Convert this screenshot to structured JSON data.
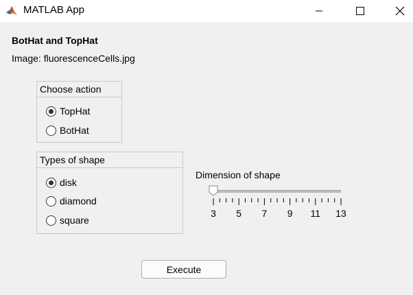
{
  "window": {
    "title": "MATLAB App"
  },
  "app": {
    "heading": "BotHat and TopHat",
    "image_label": "Image: fluorescenceCells.jpg"
  },
  "action_panel": {
    "title": "Choose action",
    "options": [
      {
        "label": "TopHat",
        "selected": true
      },
      {
        "label": "BotHat",
        "selected": false
      }
    ]
  },
  "shape_panel": {
    "title": "Types of shape",
    "options": [
      {
        "label": "disk",
        "selected": true
      },
      {
        "label": "diamond",
        "selected": false
      },
      {
        "label": "square",
        "selected": false
      }
    ]
  },
  "slider": {
    "label": "Dimension of shape",
    "min": 3,
    "max": 13,
    "value": 3,
    "major_ticks": [
      "3",
      "5",
      "7",
      "9",
      "11",
      "13"
    ]
  },
  "execute_button": {
    "label": "Execute"
  }
}
